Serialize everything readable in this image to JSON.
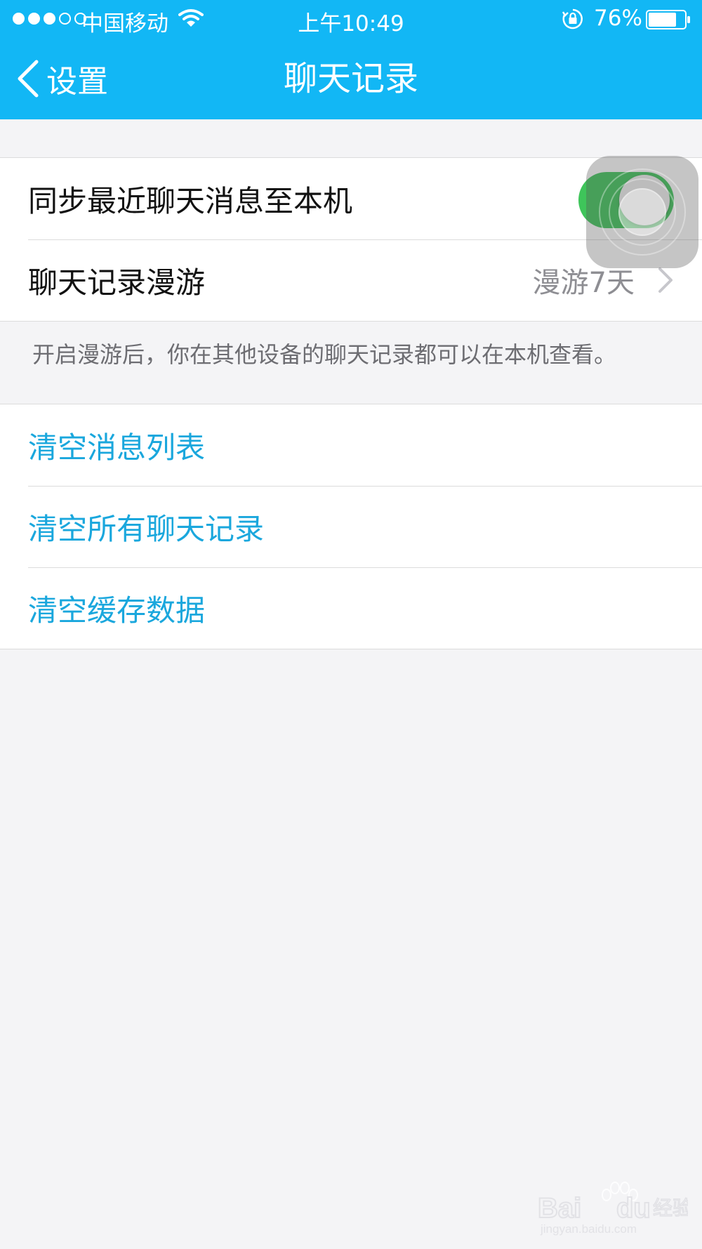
{
  "status_bar": {
    "signal_dots_filled": 3,
    "signal_dots_total": 5,
    "carrier": "中国移动",
    "time": "上午10:49",
    "battery_percent": "76%"
  },
  "nav": {
    "back_label": "设置",
    "title": "聊天记录"
  },
  "sync_section": {
    "sync_label": "同步最近聊天消息至本机",
    "sync_enabled": true,
    "roaming_label": "聊天记录漫游",
    "roaming_value": "漫游7天",
    "footnote": "开启漫游后，你在其他设备的聊天记录都可以在本机查看。"
  },
  "clear_section": {
    "items": [
      {
        "label": "清空消息列表"
      },
      {
        "label": "清空所有聊天记录"
      },
      {
        "label": "清空缓存数据"
      }
    ]
  },
  "watermark": {
    "brand": "Baidu经验",
    "url": "jingyan.baidu.com"
  },
  "colors": {
    "nav_background": "#12b7f5",
    "toggle_on": "#3ec55a",
    "action_text": "#1aa7dd",
    "page_background": "#f4f4f6"
  }
}
